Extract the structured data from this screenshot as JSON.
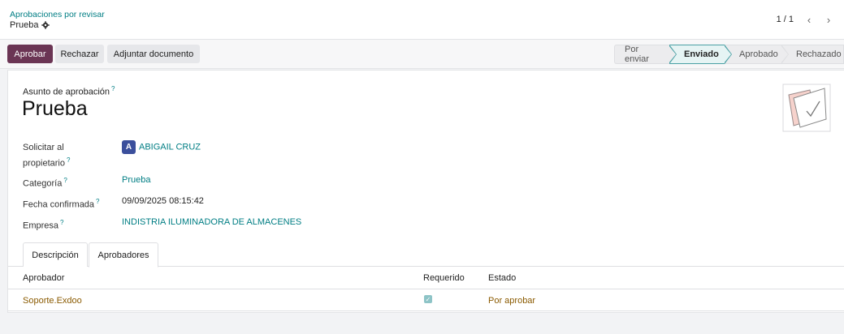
{
  "breadcrumb": {
    "parent": "Aprobaciones por revisar",
    "current": "Prueba"
  },
  "pager": {
    "value": "1 / 1",
    "prev_icon": "chevron-left-icon",
    "next_icon": "chevron-right-icon"
  },
  "actions": {
    "approve": "Aprobar",
    "reject": "Rechazar",
    "attach": "Adjuntar documento"
  },
  "status": {
    "stages": [
      "Por enviar",
      "Enviado",
      "Aprobado",
      "Rechazado"
    ],
    "active": "Enviado"
  },
  "form": {
    "subject_label": "Asunto de aprobación",
    "help_mark": "?",
    "title": "Prueba",
    "owner_label_line1": "Solicitar al",
    "owner_label_line2": "propietario",
    "owner_initial": "A",
    "owner_name": "ABIGAIL CRUZ",
    "category_label": "Categoría",
    "category_value": "Prueba",
    "date_label": "Fecha confirmada",
    "date_value": "09/09/2025 08:15:42",
    "company_label": "Empresa",
    "company_value": "INDISTRIA ILUMINADORA DE ALMACENES"
  },
  "tabs": {
    "description": "Descripción",
    "approvers": "Aprobadores"
  },
  "table": {
    "headers": {
      "approver": "Aprobador",
      "required": "Requerido",
      "state": "Estado"
    },
    "rows": [
      {
        "approver": "Soporte.Exdoo",
        "required": true,
        "state": "Por aprobar"
      }
    ]
  },
  "colors": {
    "primary": "#6b3554",
    "link": "#017e84",
    "pending": "#8a5a00"
  }
}
